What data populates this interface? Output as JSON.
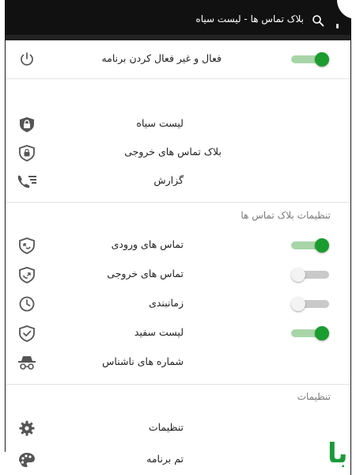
{
  "appbar": {
    "title": "بلاک تماس ها - لیست سیاه"
  },
  "master_toggle": {
    "label": "فعال و غیر فعال کردن برنامه",
    "enabled": true
  },
  "nav_items": [
    {
      "label": "لیست سیاه",
      "icon": "shield-lock-icon"
    },
    {
      "label": "بلاک تماس های خروجی",
      "icon": "shield-lock-outgoing-icon"
    },
    {
      "label": "گزارش",
      "icon": "call-log-icon"
    }
  ],
  "block_settings": {
    "header": "تنظیمات بلاک تماس ها",
    "items": [
      {
        "label": "تماس های ورودی",
        "icon": "incoming-call-shield-icon",
        "enabled": true
      },
      {
        "label": "تماس های خروجی",
        "icon": "outgoing-call-shield-icon",
        "enabled": false
      },
      {
        "label": "زمانبندی",
        "icon": "clock-icon",
        "enabled": false
      },
      {
        "label": "لیست سفید",
        "icon": "shield-check-icon",
        "enabled": true
      },
      {
        "label": "شماره های ناشناس",
        "icon": "incognito-icon"
      }
    ]
  },
  "settings": {
    "header": "تنظیمات",
    "items": [
      {
        "label": "تنظیمات",
        "icon": "gear-icon"
      },
      {
        "label": "تم برنامه",
        "icon": "palette-icon"
      }
    ]
  },
  "watermark": {
    "text": "ﺑﺎ"
  },
  "colors": {
    "appbar": "#111111",
    "accent": "#1b9c2e",
    "accent_track": "#a8d5a8",
    "header_text": "#7a7a7a"
  }
}
